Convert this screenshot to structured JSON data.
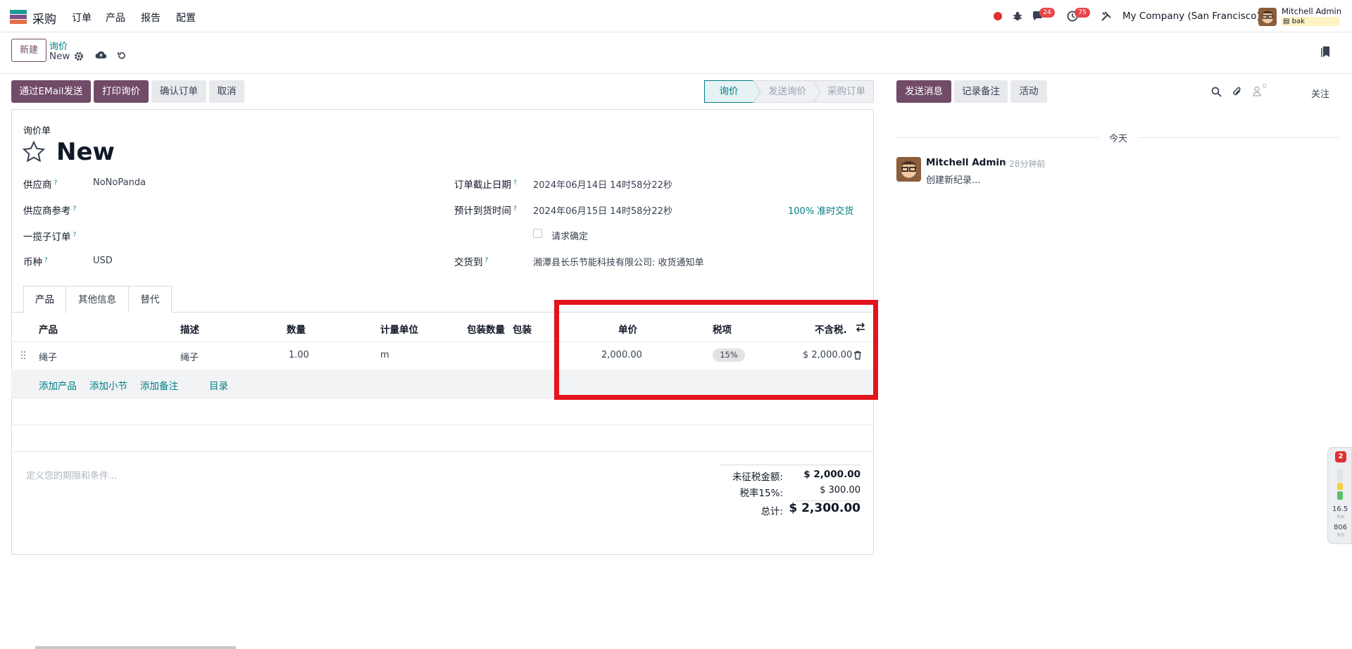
{
  "navbar": {
    "app_name": "采购",
    "menu": [
      "订单",
      "产品",
      "报告",
      "配置"
    ],
    "messages_count": "24",
    "activities_count": "75",
    "company": "My Company (San Francisco)",
    "user_name": "Mitchell Admin",
    "db_name": "bak"
  },
  "control": {
    "new_button": "新建",
    "breadcrumb_parent": "询价",
    "breadcrumb_current": "New"
  },
  "actions": {
    "send_email": "通过EMail发送",
    "print_rfq": "打印询价",
    "confirm_order": "确认订单",
    "cancel": "取消"
  },
  "status": {
    "steps": [
      "询价",
      "发送询价",
      "采购订单"
    ],
    "active": "询价"
  },
  "form": {
    "doc_type": "询价单",
    "title": "New",
    "vendor_label": "供应商",
    "vendor_value": "NoNoPanda",
    "vendor_ref_label": "供应商参考",
    "blanket_label": "一揽子订单",
    "currency_label": "币种",
    "currency_value": "USD",
    "deadline_label": "订单截止日期",
    "deadline_value": "2024年06月14日 14时58分22秒",
    "expected_label": "预计到货时间",
    "expected_value": "2024年06月15日 14时58分22秒",
    "on_time": "100% 准时交货",
    "request_confirm": "请求确定",
    "deliver_to_label": "交货到",
    "deliver_to_value": "湘潭县长乐节能科技有限公司: 收货通知单"
  },
  "tabs": [
    "产品",
    "其他信息",
    "替代"
  ],
  "lines": {
    "headers": {
      "product": "产品",
      "description": "描述",
      "quantity": "数量",
      "uom": "计量单位",
      "pkg_qty": "包装数量",
      "packaging": "包装",
      "unit_price": "单价",
      "taxes": "税项",
      "subtotal": "不含税."
    },
    "rows": [
      {
        "product": "绳子",
        "description": "绳子",
        "quantity": "1.00",
        "uom": "m",
        "unit_price": "2,000.00",
        "tax": "15%",
        "subtotal": "$ 2,000.00"
      }
    ],
    "add_product": "添加产品",
    "add_section": "添加小节",
    "add_note": "添加备注",
    "catalog": "目录"
  },
  "terms_placeholder": "定义您的期限和条件...",
  "totals": {
    "untaxed_label": "未征税金额:",
    "untaxed_value": "$ 2,000.00",
    "tax_label": "税率15%:",
    "tax_value": "$ 300.00",
    "total_label": "总计:",
    "total_value": "$ 2,300.00"
  },
  "chatter": {
    "send_message": "发送消息",
    "log_note": "记录备注",
    "activity": "活动",
    "followers_count": "0",
    "follow": "关注",
    "today": "今天",
    "message": {
      "author": "Mitchell Admin",
      "time": "- 28分钟前",
      "body": "创建新纪录..."
    }
  },
  "widget": {
    "badge": "2",
    "upload_speed": "16.5",
    "upload_unit": "K/s",
    "download_speed": "806",
    "download_unit": "K/s"
  },
  "colors": {
    "brand": "#714b67",
    "link": "#017e84",
    "highlight": "#e3141d",
    "badge": "#e5484d"
  }
}
